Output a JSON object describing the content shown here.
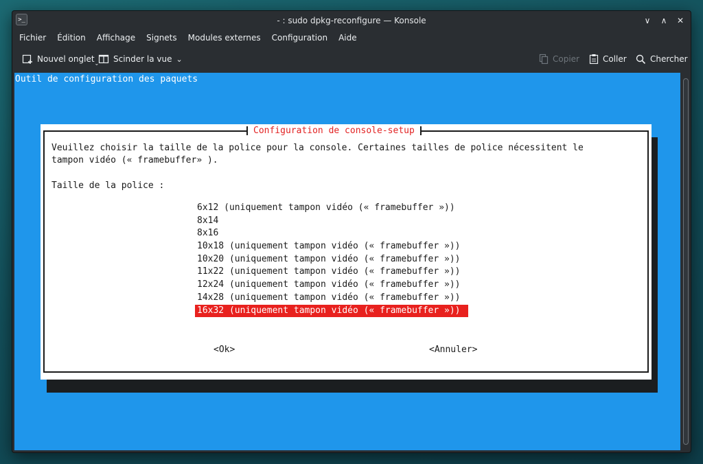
{
  "window": {
    "title": "- : sudo dpkg-reconfigure — Konsole",
    "controls": {
      "minimize": "∨",
      "maximize": "∧",
      "close": "✕"
    }
  },
  "menubar": {
    "items": [
      "Fichier",
      "Édition",
      "Affichage",
      "Signets",
      "Modules externes",
      "Configuration",
      "Aide"
    ]
  },
  "toolbar": {
    "new_tab": "Nouvel onglet",
    "split_view": "Scinder la vue",
    "copy": "Copier",
    "paste": "Coller",
    "find": "Chercher"
  },
  "terminal": {
    "header": "Outil de configuration des paquets",
    "dialog": {
      "title": "Configuration de console-setup",
      "description_line1": "Veuillez choisir la taille de la police pour la console. Certaines tailles de police nécessitent le",
      "description_line2": "tampon vidéo (« framebuffer» ).",
      "prompt": "Taille de la police :",
      "options": [
        "6x12 (uniquement tampon vidéo (« framebuffer »))",
        "8x14",
        "8x16",
        "10x18 (uniquement tampon vidéo (« framebuffer »))",
        "10x20 (uniquement tampon vidéo (« framebuffer »))",
        "11x22 (uniquement tampon vidéo (« framebuffer »))",
        "12x24 (uniquement tampon vidéo (« framebuffer »))",
        "14x28 (uniquement tampon vidéo (« framebuffer »))",
        "16x32 (uniquement tampon vidéo (« framebuffer »))"
      ],
      "selected_index": 8,
      "ok_label": "<Ok>",
      "cancel_label": "<Annuler>"
    }
  },
  "colors": {
    "terminal_bg": "#1f96eb",
    "selection": "#e8211e",
    "dialog_title": "#e22222",
    "chrome_bg": "#2a2e32"
  }
}
